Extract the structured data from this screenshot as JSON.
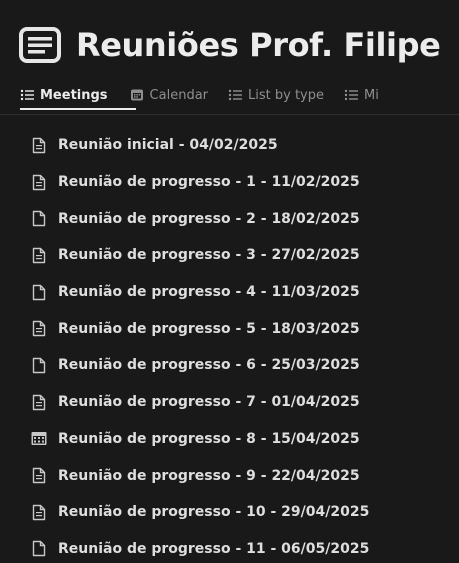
{
  "page": {
    "title": "Reuniões Prof. Filipe",
    "title_icon": "document-icon"
  },
  "tabs": [
    {
      "label": "Meetings",
      "icon": "list-icon",
      "active": true
    },
    {
      "label": "Calendar",
      "icon": "calendar-icon",
      "active": false
    },
    {
      "label": "List by type",
      "icon": "list-icon",
      "active": false
    },
    {
      "label": "Mi",
      "icon": "list-icon",
      "active": false
    }
  ],
  "meetings": [
    {
      "label": "Reunião inicial - 04/02/2025",
      "icon": "doc-lines-icon"
    },
    {
      "label": "Reunião de progresso - 1 - 11/02/2025",
      "icon": "doc-lines-icon"
    },
    {
      "label": "Reunião de progresso - 2 - 18/02/2025",
      "icon": "doc-blank-icon"
    },
    {
      "label": "Reunião de progresso - 3 - 27/02/2025",
      "icon": "doc-lines-icon"
    },
    {
      "label": "Reunião de progresso - 4 - 11/03/2025",
      "icon": "doc-blank-icon"
    },
    {
      "label": "Reunião de progresso - 5 - 18/03/2025",
      "icon": "doc-lines-icon"
    },
    {
      "label": "Reunião de progresso - 6 - 25/03/2025",
      "icon": "doc-blank-icon"
    },
    {
      "label": "Reunião de progresso - 7 - 01/04/2025",
      "icon": "doc-lines-icon"
    },
    {
      "label": "Reunião de progresso - 8 - 15/04/2025",
      "icon": "calendar-grid-icon"
    },
    {
      "label": "Reunião de progresso - 9 - 22/04/2025",
      "icon": "doc-lines-icon"
    },
    {
      "label": "Reunião de progresso - 10 - 29/04/2025",
      "icon": "doc-lines-icon"
    },
    {
      "label": "Reunião de progresso - 11 - 06/05/2025",
      "icon": "doc-blank-icon"
    }
  ],
  "colors": {
    "background": "#191919",
    "text": "#dedede",
    "muted": "#8f8f8f"
  }
}
